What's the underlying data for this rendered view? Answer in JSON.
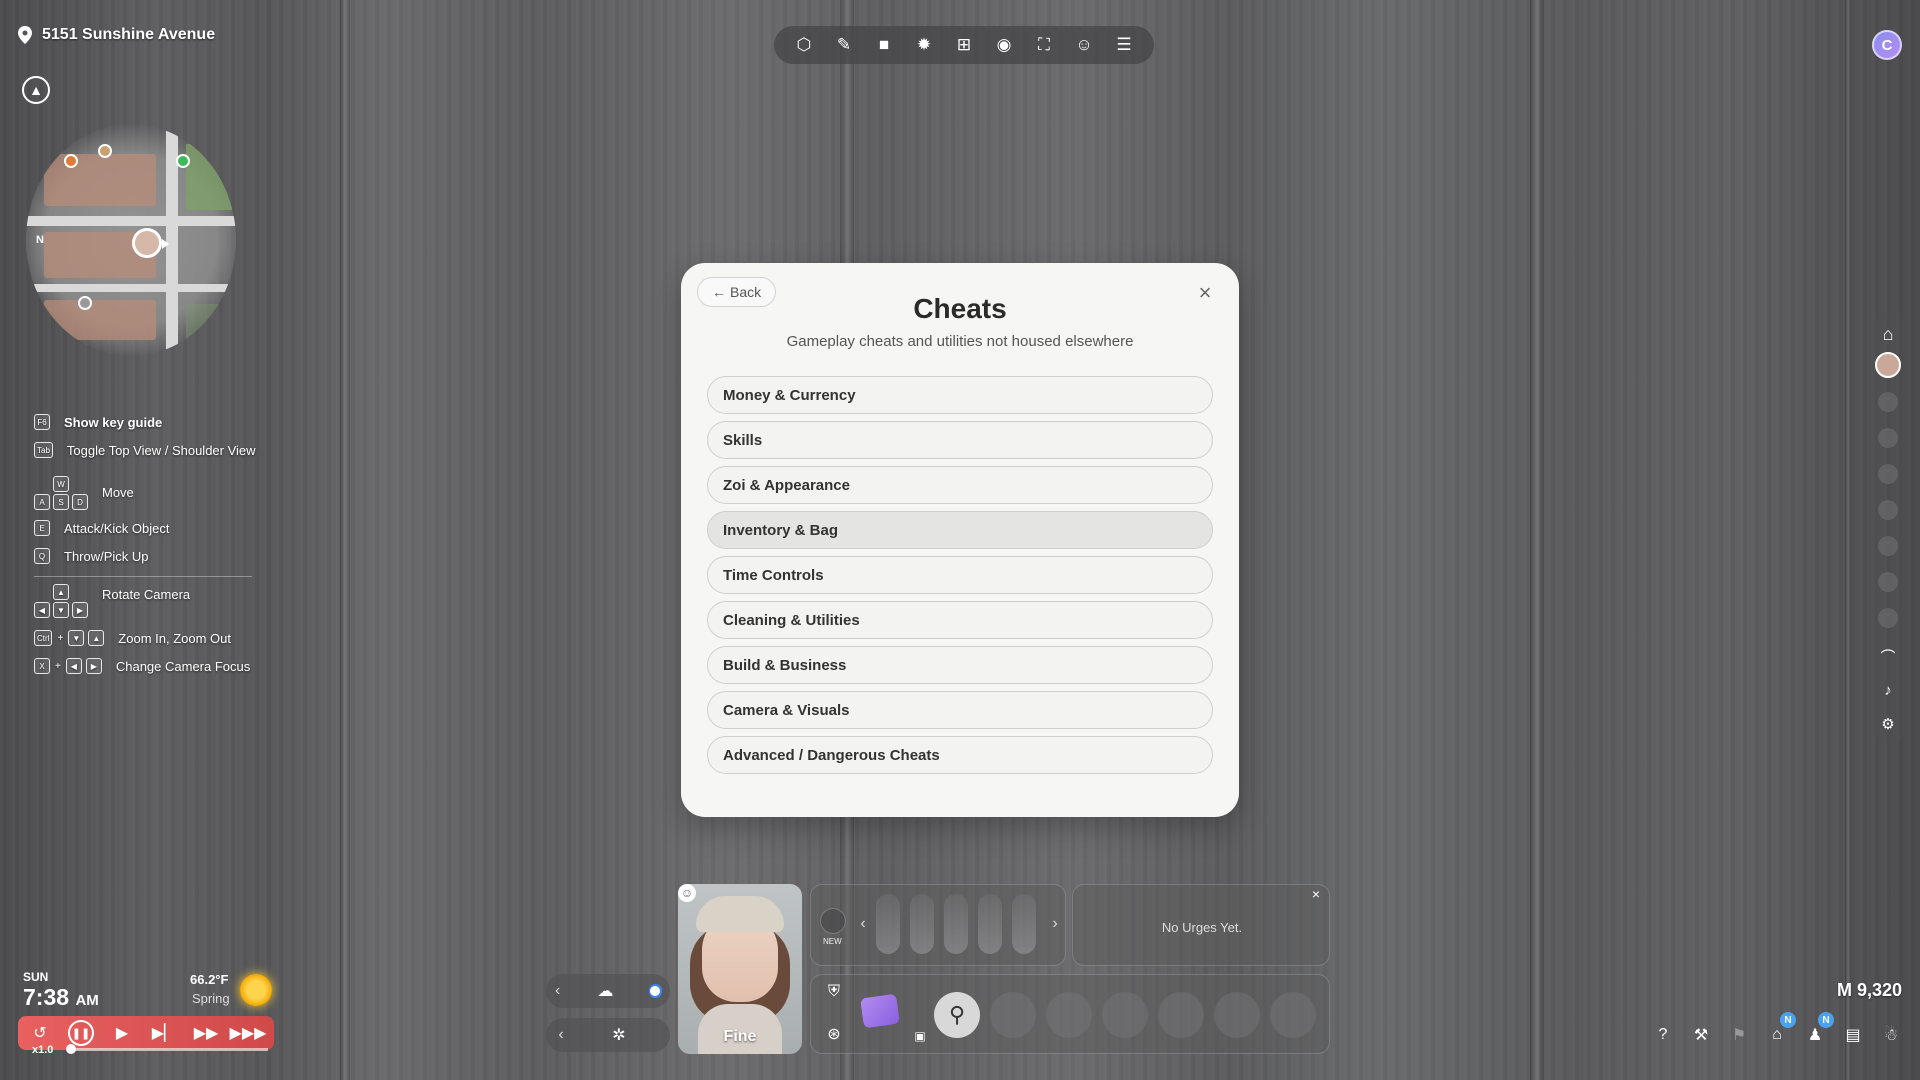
{
  "hud": {
    "location": "5151 Sunshine Avenue",
    "minimap_north_label": "N"
  },
  "key_guide": {
    "items": [
      {
        "keys": [
          "F6"
        ],
        "label": "Show key guide",
        "highlight": true
      },
      {
        "keys": [
          "Tab"
        ],
        "label": "Toggle Top View / Shoulder View"
      },
      {
        "keys": [
          "W",
          "A",
          "S",
          "D"
        ],
        "label": "Move"
      },
      {
        "keys": [
          "E"
        ],
        "label": "Attack/Kick Object"
      },
      {
        "keys": [
          "Q"
        ],
        "label": "Throw/Pick Up"
      },
      {
        "keys": [
          "▲",
          "◀",
          "▼",
          "▶"
        ],
        "label": "Rotate Camera"
      },
      {
        "keys": [
          "Ctrl",
          "+",
          "▼",
          "▲"
        ],
        "label": "Zoom In, Zoom Out"
      },
      {
        "keys": [
          "X",
          "+",
          "◀",
          "▶"
        ],
        "label": "Change Camera Focus"
      }
    ]
  },
  "toolbar": {
    "icons": [
      "build-mode-icon",
      "edit-tool-icon",
      "video-camera-icon",
      "lightbulb-icon",
      "add-frame-icon",
      "camera-icon",
      "focus-frame-icon",
      "capture-zoi-icon",
      "menu-icon"
    ]
  },
  "account_initial": "C",
  "modal": {
    "back_label": "Back",
    "title": "Cheats",
    "subtitle": "Gameplay cheats and utilities not housed elsewhere",
    "items": [
      "Money & Currency",
      "Skills",
      "Zoi & Appearance",
      "Inventory & Bag",
      "Time Controls",
      "Cleaning & Utilities",
      "Build & Business",
      "Camera & Visuals",
      "Advanced / Dangerous Cheats"
    ],
    "hovered_index": 3
  },
  "clock": {
    "day": "SUN",
    "time": "7:38",
    "ampm": "AM",
    "temperature": "66.2°F",
    "season": "Spring",
    "speed": "x1.0"
  },
  "zoi": {
    "mood": "Fine"
  },
  "needs": {
    "new_label": "NEW"
  },
  "urges": {
    "empty_text": "No Urges Yet."
  },
  "money": {
    "symbol": "M",
    "amount": "9,320"
  },
  "notification_badge": "N",
  "colors": {
    "speed_bar": "#d94f4f",
    "toggle_on": "#3b82f6",
    "badge": "#4aa3f0",
    "modal_bg": "#f6f6f5"
  }
}
